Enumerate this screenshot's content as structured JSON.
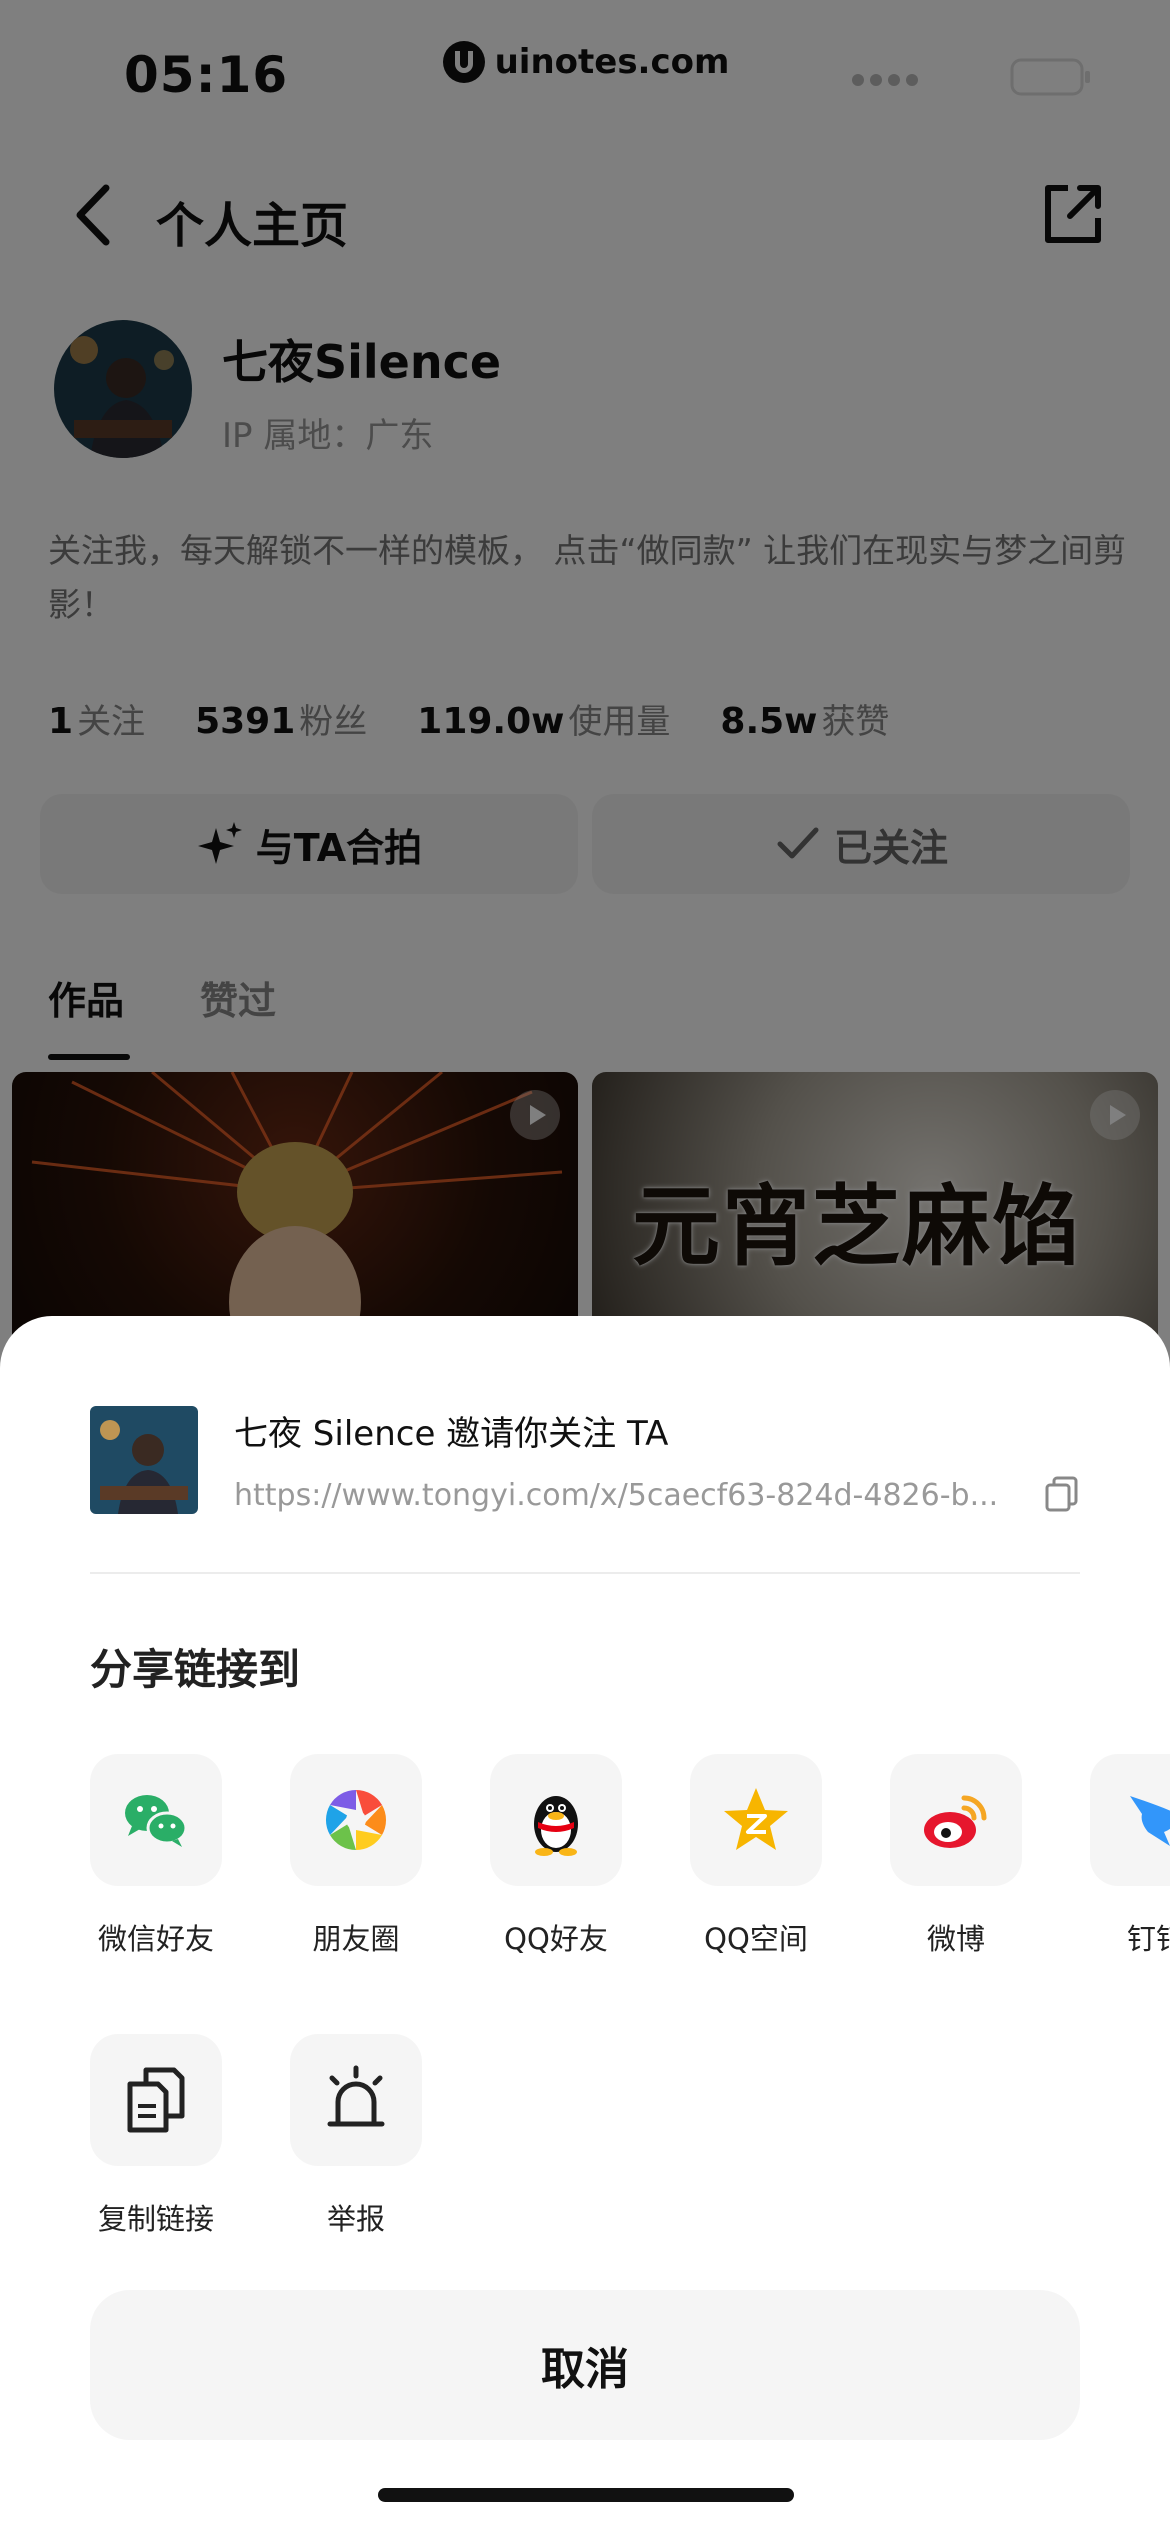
{
  "status_bar": {
    "time": "05:16",
    "watermark": "uinotes.com"
  },
  "nav": {
    "title": "个人主页"
  },
  "profile": {
    "name": "七夜Silence",
    "ip_location": "IP 属地：广东",
    "bio": "关注我，每天解锁不一样的模板， 点击“做同款” 让我们在现实与梦之间剪影！",
    "stats": [
      {
        "value": "1",
        "label": "关注"
      },
      {
        "value": "5391",
        "label": "粉丝"
      },
      {
        "value": "119.0w",
        "label": "使用量"
      },
      {
        "value": "8.5w",
        "label": "获赞"
      }
    ],
    "actions": {
      "co_shoot": "与TA合拍",
      "followed": "已关注"
    }
  },
  "tabs": [
    {
      "label": "作品",
      "active": true
    },
    {
      "label": "赞过",
      "active": false
    }
  ],
  "works": [
    {
      "overlay_text": ""
    },
    {
      "overlay_text": "元宵芝麻馅"
    }
  ],
  "share_sheet": {
    "invite_title": "七夜 Silence 邀请你关注 TA",
    "invite_url": "https://www.tongyi.com/x/5caecf63-824d-4826-b...",
    "heading": "分享链接到",
    "targets": [
      {
        "label": "微信好友",
        "icon": "wechat-icon"
      },
      {
        "label": "朋友圈",
        "icon": "moments-icon"
      },
      {
        "label": "QQ好友",
        "icon": "qq-icon"
      },
      {
        "label": "QQ空间",
        "icon": "qzone-icon"
      },
      {
        "label": "微博",
        "icon": "weibo-icon"
      },
      {
        "label": "钉钉",
        "icon": "dingtalk-icon"
      }
    ],
    "tools": [
      {
        "label": "复制链接",
        "icon": "copy-link-icon"
      },
      {
        "label": "举报",
        "icon": "report-icon"
      }
    ],
    "cancel": "取消"
  },
  "colors": {
    "overlay": "#00000080",
    "wechat": "#2aae67",
    "qzone": "#f7b500",
    "weibo": "#e6162d",
    "dingtalk": "#3296fa"
  }
}
